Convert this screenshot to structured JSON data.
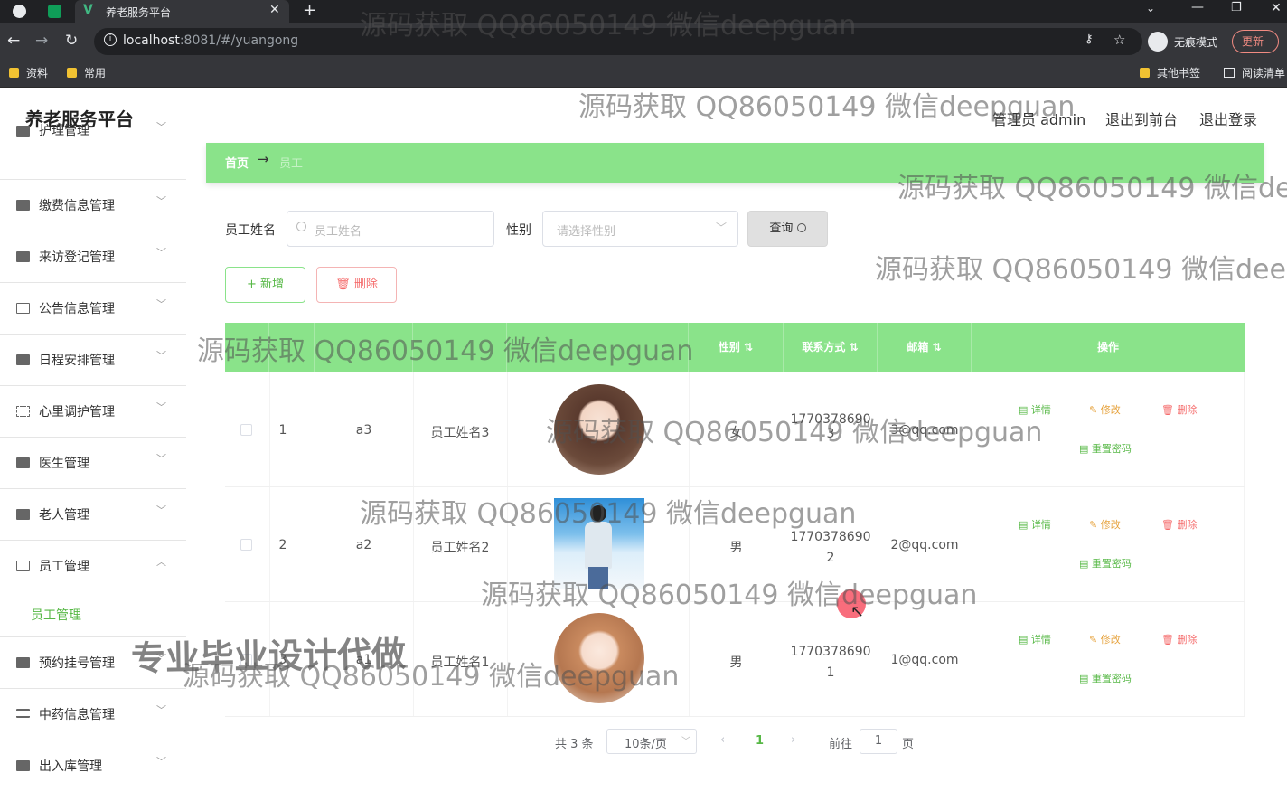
{
  "browser": {
    "tab_title": "养老服务平台",
    "url_host": "localhost",
    "url_rest": ":8081/#/yuangong",
    "incognito_label": "无痕模式",
    "update_label": "更新",
    "bookmarks": [
      "资料",
      "常用"
    ],
    "other_bookmarks": "其他书签",
    "reading_list": "阅读清单"
  },
  "app": {
    "title": "养老服务平台",
    "user_label": "管理员 admin",
    "to_front": "退出到前台",
    "logout": "退出登录"
  },
  "sidebar": {
    "items": [
      {
        "label": "护理管理",
        "icon": "printer-icon"
      },
      {
        "label": "缴费信息管理",
        "icon": "bar-chart-icon"
      },
      {
        "label": "来访登记管理",
        "icon": "line-chart-icon"
      },
      {
        "label": "公告信息管理",
        "icon": "mail-icon"
      },
      {
        "label": "日程安排管理",
        "icon": "pin-icon"
      },
      {
        "label": "心里调护管理",
        "icon": "fullscreen-icon"
      },
      {
        "label": "医生管理",
        "icon": "document-icon"
      },
      {
        "label": "老人管理",
        "icon": "delete-box-icon"
      },
      {
        "label": "员工管理",
        "icon": "id-card-icon"
      },
      {
        "label": "预约挂号管理",
        "icon": "lock-icon"
      },
      {
        "label": "中药信息管理",
        "icon": "list-icon"
      },
      {
        "label": "出入库管理",
        "icon": "box-icon"
      }
    ],
    "sub_item": "员工管理"
  },
  "breadcrumb": {
    "home": "首页",
    "arrow": "→",
    "current": "员工"
  },
  "search": {
    "name_label": "员工姓名",
    "name_placeholder": "员工姓名",
    "gender_label": "性别",
    "gender_placeholder": "请选择性别",
    "query_button": "查询"
  },
  "actions": {
    "add": "新增",
    "delete": "删除"
  },
  "table": {
    "headers": [
      "",
      "",
      "",
      "",
      "",
      "性别",
      "联系方式",
      "邮箱",
      "操作"
    ],
    "rows": [
      {
        "index": "1",
        "account": "a3",
        "name": "员工姓名3",
        "gender": "女",
        "phone1": "1770378690",
        "phone2": "3",
        "email": "3@qq.com"
      },
      {
        "index": "2",
        "account": "a2",
        "name": "员工姓名2",
        "gender": "男",
        "phone1": "1770378690",
        "phone2": "2",
        "email": "2@qq.com"
      },
      {
        "index": "3",
        "account": "a1",
        "name": "员工姓名1",
        "gender": "男",
        "phone1": "1770378690",
        "phone2": "1",
        "email": "1@qq.com"
      }
    ],
    "ops": {
      "detail": "详情",
      "edit": "修改",
      "delete": "删除",
      "reset": "重置密码"
    }
  },
  "pagination": {
    "total": "共 3 条",
    "page_size": "10条/页",
    "current": "1",
    "goto_prefix": "前往",
    "goto_value": "1",
    "goto_suffix": "页"
  },
  "overlays": {
    "watermark": "源码获取 QQ86050149 微信deepguan",
    "promo": "专业毕业设计代做"
  },
  "colors": {
    "accent": "#8ae38a",
    "active_text": "#57b846",
    "danger": "#f56c6c",
    "warning": "#e6a23c"
  }
}
